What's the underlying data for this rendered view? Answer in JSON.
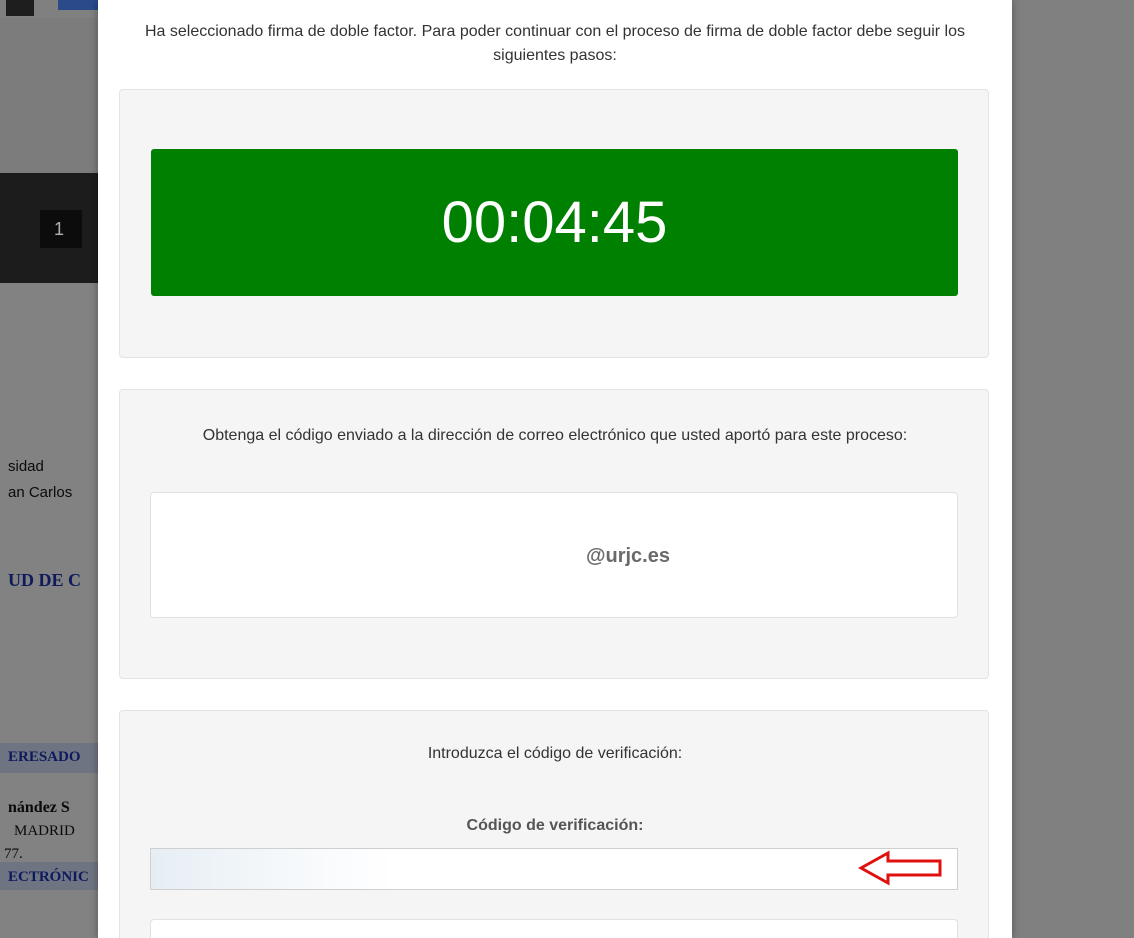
{
  "background": {
    "page_number": "1",
    "lines": [
      "sidad",
      "an Carlos"
    ],
    "heading": "UD DE C",
    "band_1": "ERESADO",
    "person_lines": [
      "nández  S",
      "MADRID",
      "77."
    ],
    "band_2": "ECTRÓNIC"
  },
  "modal": {
    "intro": "Ha seleccionado firma de doble factor. Para poder continuar con el proceso de firma de doble factor debe seguir los siguientes pasos:",
    "timer": {
      "value": "00:04:45",
      "color": "#008000"
    },
    "email_step": {
      "instruction": "Obtenga el código enviado a la dirección de correo electrónico que usted aportó para este proceso:",
      "email": "@urjc.es"
    },
    "code_step": {
      "instruction": "Introduzca el código de verificación:",
      "field_label": "Código de verificación:",
      "value": "",
      "arrow_color": "#e01010",
      "arrow_icon": "left-arrow-icon"
    }
  }
}
